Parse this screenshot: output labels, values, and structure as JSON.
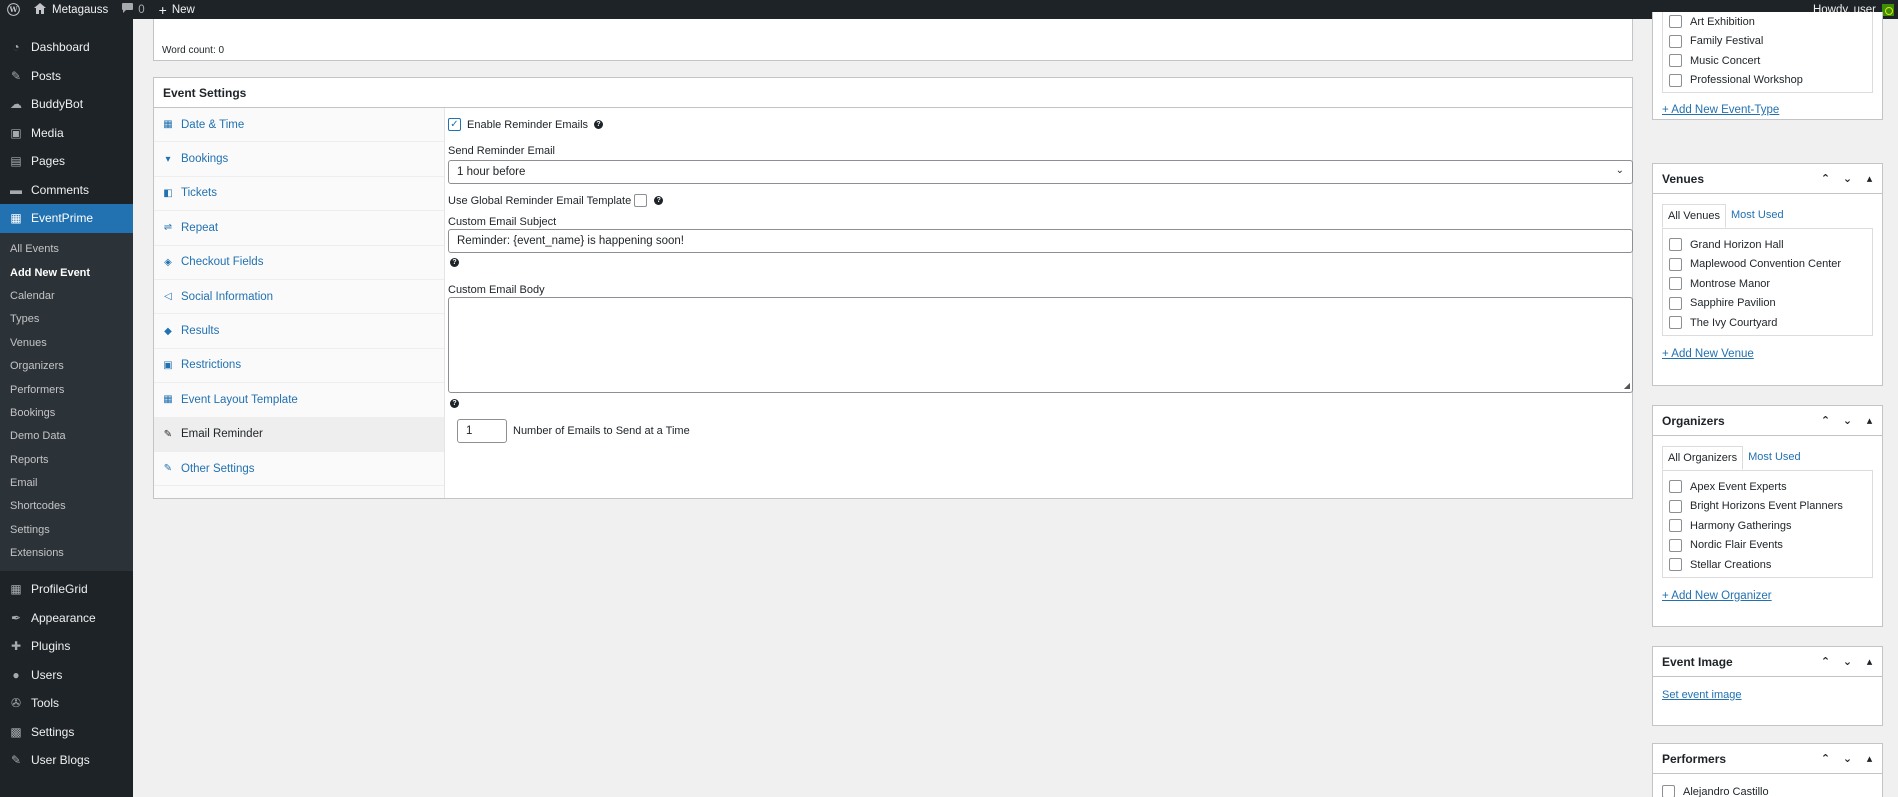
{
  "adminbar": {
    "site_name": "Metagauss",
    "comments_count": "0",
    "new_label": "New",
    "howdy": "Howdy, user"
  },
  "sidebar": {
    "items_top": [
      {
        "label": "Dashboard",
        "icon": "dashboard-icon"
      },
      {
        "label": "Posts",
        "icon": "pin-icon"
      },
      {
        "label": "BuddyBot",
        "icon": "chat-icon"
      },
      {
        "label": "Media",
        "icon": "media-icon"
      },
      {
        "label": "Pages",
        "icon": "page-icon"
      },
      {
        "label": "Comments",
        "icon": "comment-icon"
      },
      {
        "label": "EventPrime",
        "icon": "eventprime-icon"
      }
    ],
    "submenu": [
      "All Events",
      "Add New Event",
      "Calendar",
      "Types",
      "Venues",
      "Organizers",
      "Performers",
      "Bookings",
      "Demo Data",
      "Reports",
      "Email",
      "Shortcodes",
      "Settings",
      "Extensions"
    ],
    "items_bottom": [
      {
        "label": "ProfileGrid",
        "icon": "grid-icon"
      },
      {
        "label": "Appearance",
        "icon": "brush-icon"
      },
      {
        "label": "Plugins",
        "icon": "plugin-icon"
      },
      {
        "label": "Users",
        "icon": "user-icon"
      },
      {
        "label": "Tools",
        "icon": "wrench-icon"
      },
      {
        "label": "Settings",
        "icon": "settings-icon"
      },
      {
        "label": "User Blogs",
        "icon": "pin-icon"
      }
    ]
  },
  "editor": {
    "word_count": "Word count: 0"
  },
  "event_settings": {
    "title": "Event Settings",
    "tabs": [
      "Date & Time",
      "Bookings",
      "Tickets",
      "Repeat",
      "Checkout Fields",
      "Social Information",
      "Results",
      "Restrictions",
      "Event Layout Template",
      "Email Reminder",
      "Other Settings"
    ],
    "panel": {
      "enable_label": "Enable Reminder Emails",
      "send_label": "Send Reminder Email",
      "send_value": "1 hour before",
      "global_template_label": "Use Global Reminder Email Template",
      "subject_label": "Custom Email Subject",
      "subject_value": "Reminder: {event_name} is happening soon!",
      "body_label": "Custom Email Body",
      "num_value": "1",
      "num_label": "Number of Emails to Send at a Time"
    }
  },
  "right": {
    "types": {
      "items": [
        "Art Exhibition",
        "Family Festival",
        "Music Concert",
        "Professional Workshop"
      ],
      "add_link": "+ Add New Event-Type"
    },
    "venues": {
      "title": "Venues",
      "tab_all": "All Venues",
      "tab_most": "Most Used",
      "items": [
        "Grand Horizon Hall",
        "Maplewood Convention Center",
        "Montrose Manor",
        "Sapphire Pavilion",
        "The Ivy Courtyard"
      ],
      "add_link": "+ Add New Venue"
    },
    "organizers": {
      "title": "Organizers",
      "tab_all": "All Organizers",
      "tab_most": "Most Used",
      "items": [
        "Apex Event Experts",
        "Bright Horizons Event Planners",
        "Harmony Gatherings",
        "Nordic Flair Events",
        "Stellar Creations"
      ],
      "add_link": "+ Add New Organizer"
    },
    "event_image": {
      "title": "Event Image",
      "link": "Set event image"
    },
    "performers": {
      "title": "Performers",
      "first_item": "Alejandro Castillo"
    }
  }
}
